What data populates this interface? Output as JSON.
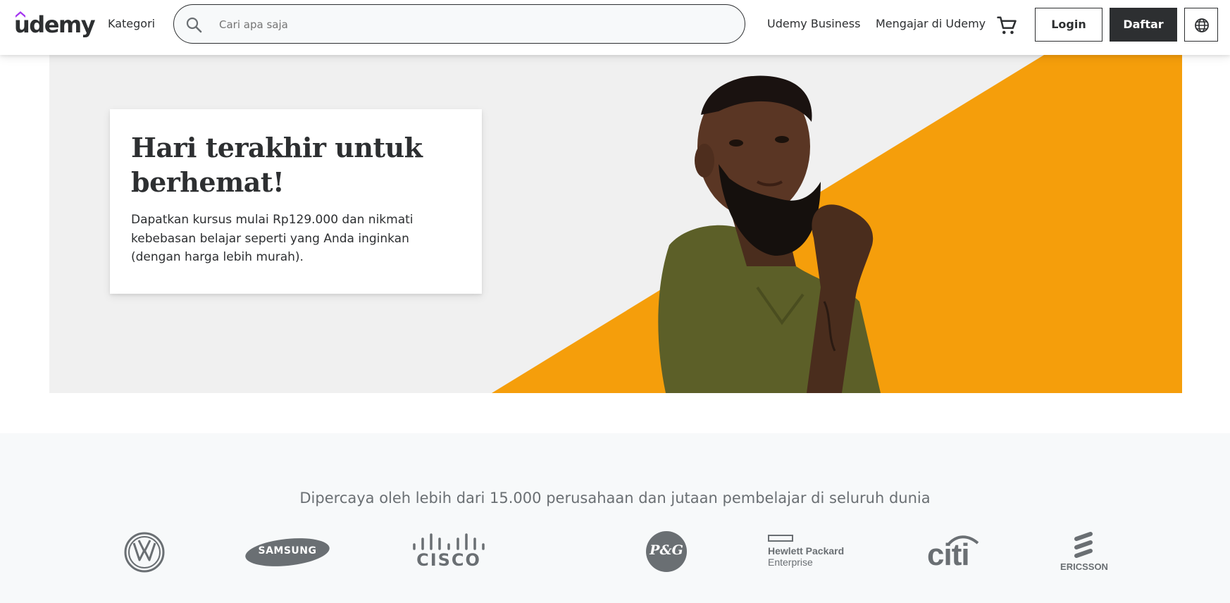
{
  "header": {
    "logo_text": "udemy",
    "categories_label": "Kategori",
    "search_placeholder": "Cari apa saja",
    "business_label": "Udemy Business",
    "teach_label": "Mengajar di Udemy",
    "login_label": "Login",
    "signup_label": "Daftar"
  },
  "hero": {
    "title": "Hari terakhir untuk berhemat!",
    "text": "Dapatkan kursus mulai Rp129.000 dan nikmati kebebasan belajar seperti yang Anda inginkan (dengan harga lebih murah)."
  },
  "trusted": {
    "title": "Dipercaya oleh lebih dari 15.000 perusahaan dan jutaan pembelajar di seluruh dunia",
    "logos": {
      "vw": "VW",
      "samsung": "SAMSUNG",
      "cisco": "CISCO",
      "pg": "P&G",
      "hpe_line1": "Hewlett Packard",
      "hpe_line2": "Enterprise",
      "citi": "citi",
      "ericsson": "ERICSSON"
    }
  },
  "colors": {
    "accent_orange": "#f59e0b",
    "dark": "#2d2f31",
    "brand_purple": "#a435f0",
    "shirt_olive": "#5c5f28"
  },
  "icons": [
    "search-icon",
    "cart-icon",
    "globe-icon"
  ]
}
